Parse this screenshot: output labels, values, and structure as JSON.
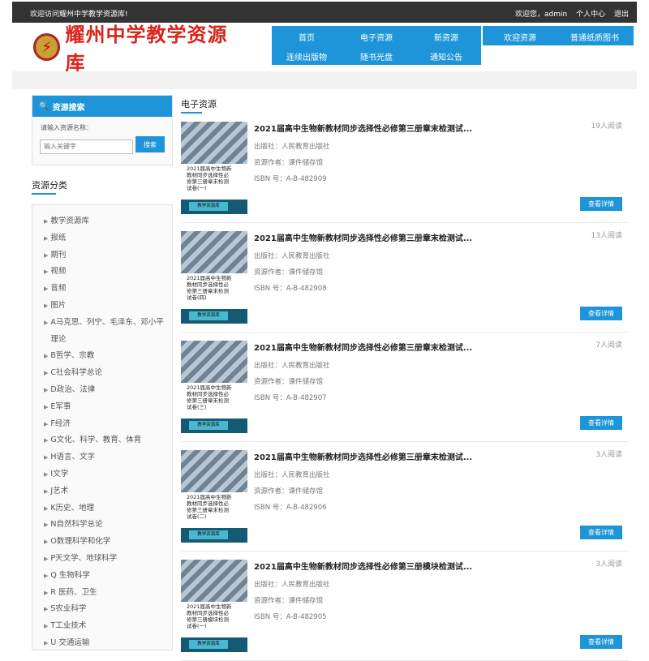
{
  "topbar": {
    "welcome": "欢迎访问耀州中学教学资源库!",
    "greeting": "欢迎您，admin",
    "user_center": "个人中心",
    "logout": "退出"
  },
  "logo": {
    "text": "耀州中学教学资源库"
  },
  "nav": {
    "items": [
      "首页",
      "电子资源",
      "新资源",
      "连续出版物",
      "随书光盘",
      "通知公告"
    ],
    "extra": [
      "欢迎资源",
      "普通纸质图书"
    ]
  },
  "search": {
    "title": "资源搜索",
    "label": "请输入资源名称：",
    "placeholder": "输入关键字",
    "button": "搜索"
  },
  "categories": {
    "title": "资源分类",
    "items": [
      "教学资源库",
      "报纸",
      "期刊",
      "视频",
      "音频",
      "图片",
      "A马克思、列宁、毛泽东、邓小平理论",
      "B哲学、宗教",
      "C社会科学总论",
      "D政治、法律",
      "E军事",
      "F经济",
      "G文化、科学、教育、体育",
      "H语言、文字",
      "I文学",
      "J艺术",
      "K历史、地理",
      "N自然科学总论",
      "O数理科学和化学",
      "P天文学、地球科学",
      "Q 生物科学",
      "R 医药、卫生",
      "S农业科学",
      "T工业技术",
      "U 交通运输"
    ]
  },
  "main": {
    "title": "电子资源"
  },
  "resources": [
    {
      "title": "2021届高中生物新教材同步选择性必修第三册章末检测试...",
      "reads": "19人阅读",
      "publisher": "出版社：人民教育出版社",
      "provider": "资源作者：课件储存馆",
      "isbn": "ISBN 号：A-B-482909",
      "cover_text": "2021届高中生物新\n教材同步选择性必\n修第三册章末检测\n试卷(一)",
      "cover_label": "教学资源库",
      "button": "查看详情"
    },
    {
      "title": "2021届高中生物新教材同步选择性必修第三册章末检测试...",
      "reads": "13人阅读",
      "publisher": "出版社：人民教育出版社",
      "provider": "资源作者：课件储存馆",
      "isbn": "ISBN 号：A-B-482908",
      "cover_text": "2021届高中生物新\n教材同步选择性必\n修第三册章末检测\n试卷(四)",
      "cover_label": "教学资源库",
      "button": "查看详情"
    },
    {
      "title": "2021届高中生物新教材同步选择性必修第三册章末检测试...",
      "reads": "7人阅读",
      "publisher": "出版社：人民教育出版社",
      "provider": "资源作者：课件储存馆",
      "isbn": "ISBN 号：A-B-482907",
      "cover_text": "2021届高中生物新\n教材同步选择性必\n修第三册章末检测\n试卷(三)",
      "cover_label": "教学资源库",
      "button": "查看详情"
    },
    {
      "title": "2021届高中生物新教材同步选择性必修第三册章末检测试...",
      "reads": "3人阅读",
      "publisher": "出版社：人民教育出版社",
      "provider": "资源作者：课件储存馆",
      "isbn": "ISBN 号：A-B-482906",
      "cover_text": "2021届高中生物新\n教材同步选择性必\n修第三册章末检测\n试卷(二)",
      "cover_label": "教学资源库",
      "button": "查看详情"
    },
    {
      "title": "2021届高中生物新教材同步选择性必修第三册模块检测试...",
      "reads": "3人阅读",
      "publisher": "出版社：人民教育出版社",
      "provider": "资源作者：课件储存馆",
      "isbn": "ISBN 号：A-B-482905",
      "cover_text": "2021届高中生物新\n教材同步选择性必\n修第三册模块检测\n试卷(一)",
      "cover_label": "教学资源库",
      "button": "查看详情"
    }
  ]
}
